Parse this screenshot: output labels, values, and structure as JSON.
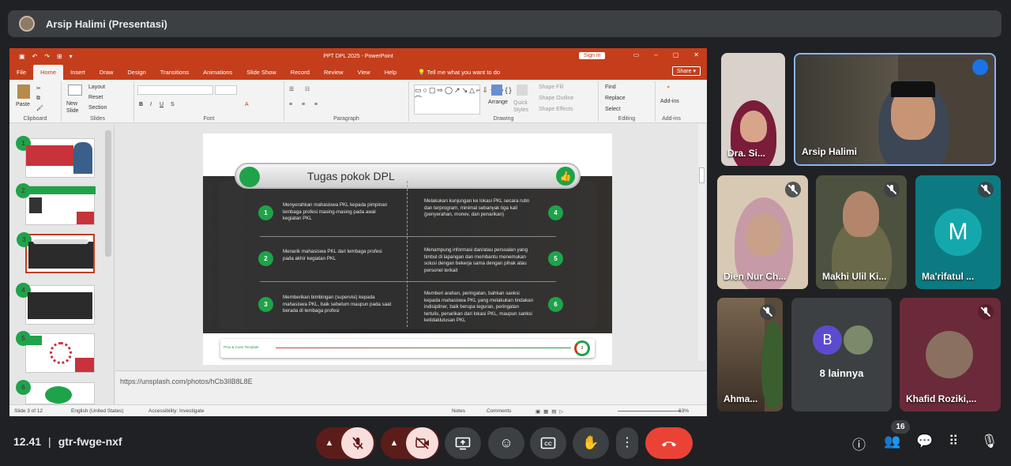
{
  "presenter_bar": {
    "name": "Arsip Halimi (Presentasi)"
  },
  "ppt": {
    "doc_title": "PPT DPL 2025  -  PowerPoint",
    "sign_in": "Sign in",
    "menu": [
      "File",
      "Home",
      "Insert",
      "Draw",
      "Design",
      "Transitions",
      "Animations",
      "Slide Show",
      "Record",
      "Review",
      "View",
      "Help"
    ],
    "tell_me": "Tell me what you want to do",
    "share": "Share",
    "groups": {
      "clipboard": "Clipboard",
      "slides": "Slides",
      "font": "Font",
      "paragraph": "Paragraph",
      "drawing": "Drawing",
      "editing": "Editing",
      "addins": "Add-ins"
    },
    "buttons": {
      "paste": "Paste",
      "new_slide": "New Slide",
      "layout": "Layout",
      "reset": "Reset",
      "section": "Section",
      "arrange": "Arrange",
      "quick_styles": "Quick Styles",
      "shape_fill": "Shape Fill",
      "shape_outline": "Shape Outline",
      "shape_effects": "Shape Effects",
      "find": "Find",
      "replace": "Replace",
      "select": "Select",
      "addins": "Add-ins"
    },
    "thumb_numbers": [
      "1",
      "2",
      "3",
      "4",
      "5",
      "6"
    ],
    "slide": {
      "title": "Tugas pokok DPL",
      "tasks": [
        {
          "n": "1",
          "text": "Menyerahkan mahasiswa PKL kepada pimpinan lembaga profesi masing-masing pada awal kegiatan PKL"
        },
        {
          "n": "2",
          "text": "Menarik mahasiswa PKL dari lembaga profesi pada akhir kegiatan PKL"
        },
        {
          "n": "3",
          "text": "Memberikan bimbingan (supervisi) kepada mahasiswa PKL, baik sebelum maupun pada saat berada di lembaga profesi"
        },
        {
          "n": "4",
          "text": "Melakukan kunjungan ke lokasi PKL secara rutin dan terprogram, minimal sebanyak tiga kali (penyerahan, monev, dan penarikan)"
        },
        {
          "n": "5",
          "text": "Menampung informasi dan/atau persoalan yang timbul di lapangan dan membantu menemukan solusi dengan bekerja sama dengan pihak atau personel terkait"
        },
        {
          "n": "6",
          "text": "Memberi arahan, peringatan, bahkan sanksi kepada mahasiswa PKL yang melakukan tindakan indisipliner, baik berupa teguran, peringatan tertulis, penarikan dari lokasi PKL, maupun sanksi ketidaklulusan PKL"
        }
      ],
      "footer_brand": "Pros & Cons Template",
      "page": "3"
    },
    "notes_text": "https://unsplash.com/photos/hCb3lIB8L8E",
    "status": {
      "slide": "Slide 3 of 12",
      "language": "English (United States)",
      "accessibility": "Accessibility: Investigate",
      "notes": "Notes",
      "comments": "Comments",
      "zoom": "63%"
    }
  },
  "participants": [
    {
      "name": "Dra. Si..."
    },
    {
      "name": "Arsip Halimi"
    },
    {
      "name": "Dien Nur Ch..."
    },
    {
      "name": "Makhi Ulil Ki..."
    },
    {
      "name": "Ma'rifatul ...",
      "initial": "M"
    },
    {
      "name": "Ahma..."
    },
    {
      "name": "8 lainnya",
      "initial": "B"
    },
    {
      "name": "Khafid Roziki,..."
    }
  ],
  "meeting": {
    "time": "12.41",
    "code": "gtr-fwge-nxf",
    "people_count": "16"
  },
  "colors": {
    "accent_green": "#1fa34a",
    "ppt_red": "#c43e1c",
    "end_call": "#ea4335"
  }
}
